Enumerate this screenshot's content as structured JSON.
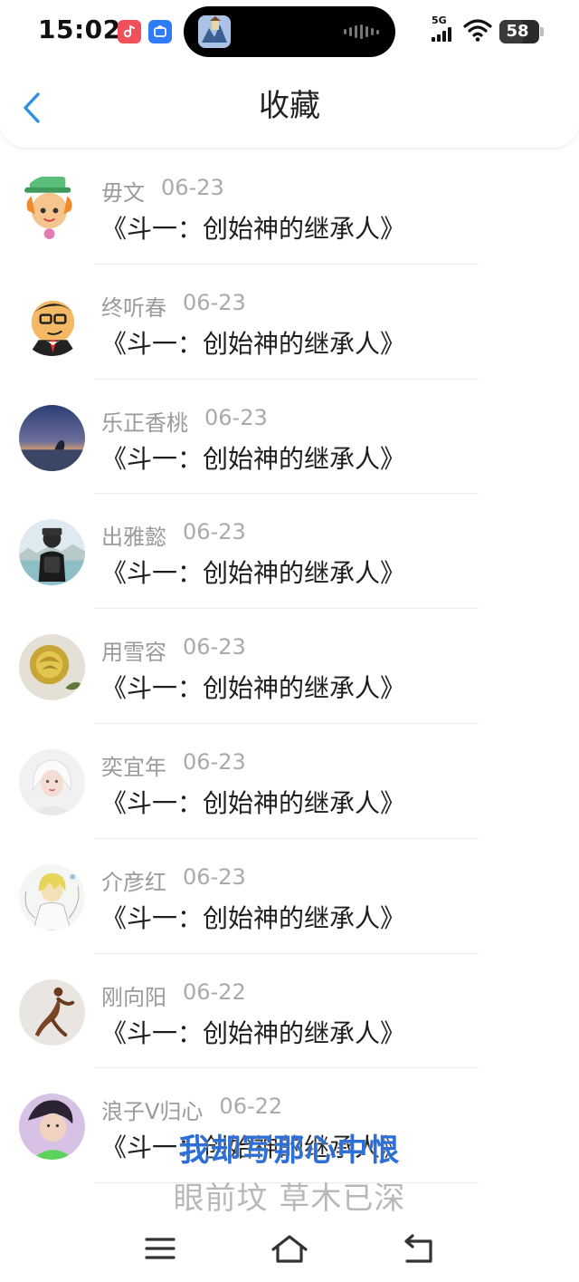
{
  "status_bar": {
    "time": "15:02",
    "network": "5G",
    "battery_level": "58",
    "battery_fraction": 0.58
  },
  "header": {
    "title": "收藏",
    "back_icon": "chevron-left-icon"
  },
  "list": {
    "items": [
      {
        "name": "毋文",
        "date": "06-23",
        "book": "《斗一：创始神的继承人》",
        "avatar_icon": "cartoon-hatter-avatar"
      },
      {
        "name": "终听春",
        "date": "06-23",
        "book": "《斗一：创始神的继承人》",
        "avatar_icon": "cartoon-glasses-man-avatar"
      },
      {
        "name": "乐正香桃",
        "date": "06-23",
        "book": "《斗一：创始神的继承人》",
        "avatar_icon": "sunset-silhouette-avatar"
      },
      {
        "name": "出雅懿",
        "date": "06-23",
        "book": "《斗一：创始神的继承人》",
        "avatar_icon": "boy-backpack-avatar"
      },
      {
        "name": "用雪容",
        "date": "06-23",
        "book": "《斗一：创始神的继承人》",
        "avatar_icon": "yellow-rose-avatar"
      },
      {
        "name": "奕宜年",
        "date": "06-23",
        "book": "《斗一：创始神的继承人》",
        "avatar_icon": "white-hair-girl-avatar"
      },
      {
        "name": "介彦红",
        "date": "06-23",
        "book": "《斗一：创始神的继承人》",
        "avatar_icon": "anime-blonde-avatar"
      },
      {
        "name": "刚向阳",
        "date": "06-22",
        "book": "《斗一：创始神的继承人》",
        "avatar_icon": "bronze-sculpture-avatar"
      },
      {
        "name": "浪子V归心",
        "date": "06-22",
        "book": "《斗一：创始神的继承人》",
        "avatar_icon": "green-shirt-boy-avatar"
      }
    ]
  },
  "lyrics": {
    "current_line": "我却写那心中恨",
    "next_line": "眼前坟 草木已深"
  },
  "system_nav": {
    "menu_icon": "menu-icon",
    "home_icon": "home-icon",
    "back_icon": "back-arrow-icon"
  },
  "colors": {
    "accent": "#2f8fe0",
    "lyric_highlight": "#2d6fd6",
    "meta_text": "#9a9a9a"
  }
}
